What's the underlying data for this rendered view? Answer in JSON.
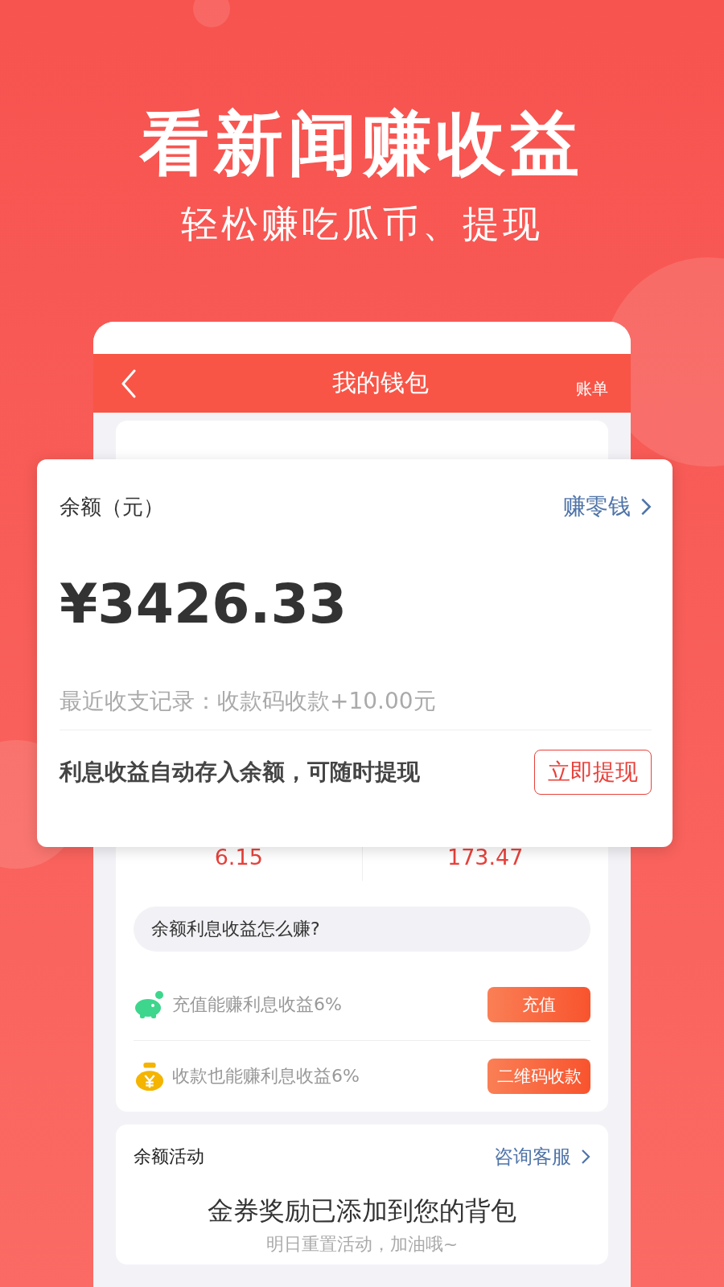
{
  "headline": "看新闻赚收益",
  "subheadline": "轻松赚吃瓜币、提现",
  "nav": {
    "title": "我的钱包",
    "action": "账单"
  },
  "balance_card": {
    "label": "余额（元）",
    "link": "赚零钱",
    "amount": "¥3426.33",
    "recent": "最近收支记录：收款码收款+10.00元",
    "note": "利息收益自动存入余额，可随时提现",
    "button": "立即提现"
  },
  "stats": [
    {
      "value": "6.15"
    },
    {
      "value": "173.47"
    }
  ],
  "question": "余额利息收益怎么赚?",
  "offers": [
    {
      "kind": "piggy",
      "text": "充值能赚利息收益6%",
      "button": "充值"
    },
    {
      "kind": "moneybag",
      "text": "收款也能赚利息收益6%",
      "button": "二维码收款"
    }
  ],
  "activity": {
    "title": "余额活动",
    "link": "咨询客服",
    "message": "金券奖励已添加到您的背包",
    "sub": "明日重置活动，加油哦~"
  }
}
